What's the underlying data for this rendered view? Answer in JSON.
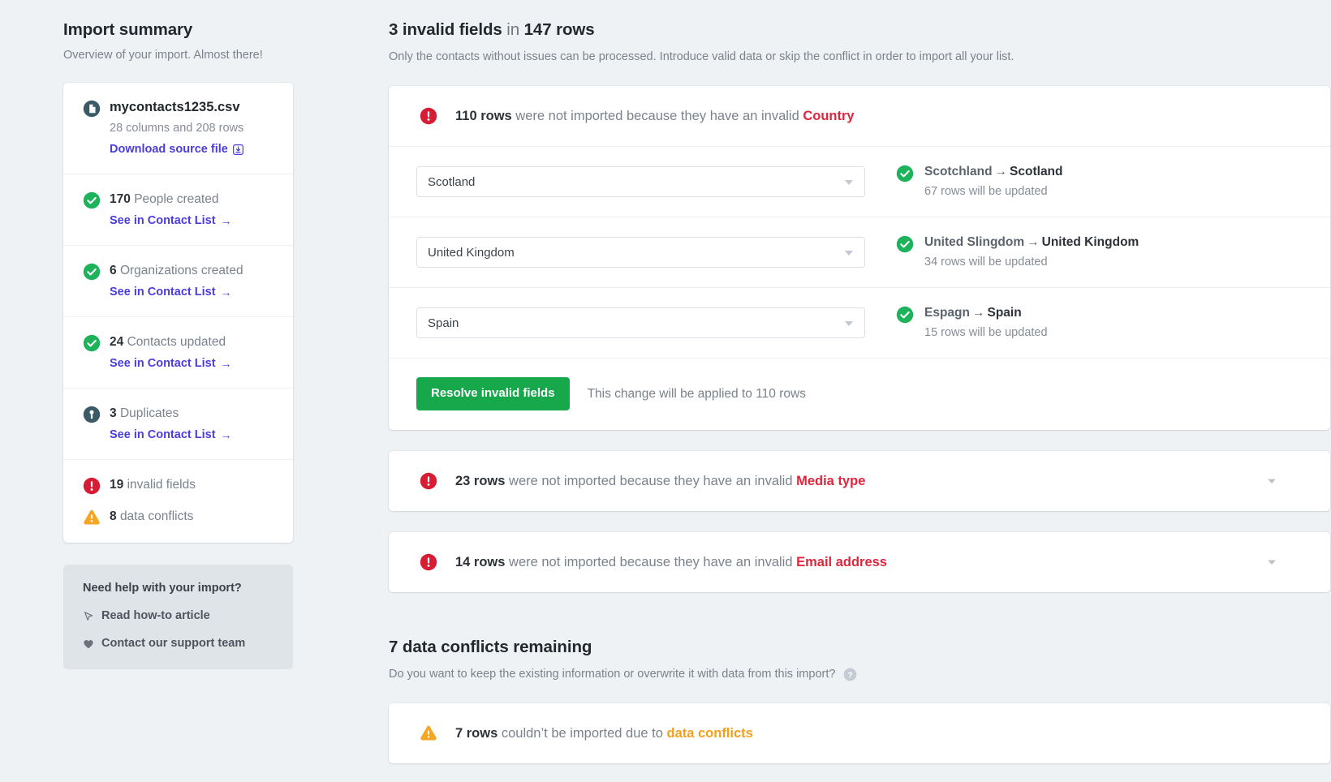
{
  "sidebar": {
    "title": "Import summary",
    "subtitle": "Overview of your import. Almost there!",
    "file": {
      "icon": "file-icon",
      "name": "mycontacts1235.csv",
      "meta": "28 columns and 208 rows",
      "download_label": "Download source file",
      "download_icon": "download-icon"
    },
    "stats": [
      {
        "icon": "check-circle-icon",
        "count": "170",
        "label": "People created",
        "link": "See in Contact List",
        "link_arrow": "→"
      },
      {
        "icon": "check-circle-icon",
        "count": "6",
        "label": "Organizations created",
        "link": "See in Contact List",
        "link_arrow": "→"
      },
      {
        "icon": "check-circle-icon",
        "count": "24",
        "label": "Contacts updated",
        "link": "See in Contact List",
        "link_arrow": "→"
      },
      {
        "icon": "duplicate-icon",
        "count": "3",
        "label": "Duplicates",
        "link": "See in Contact List",
        "link_arrow": "→"
      }
    ],
    "issues": [
      {
        "icon": "error-circle-icon",
        "count": "19",
        "label": "invalid fields"
      },
      {
        "icon": "warning-triangle-icon",
        "count": "8",
        "label": "data conflicts"
      }
    ],
    "help": {
      "title": "Need help with your import?",
      "links": [
        {
          "icon": "cursor-icon",
          "label": "Read how-to article"
        },
        {
          "icon": "heart-icon",
          "label": "Contact our support team"
        }
      ]
    }
  },
  "main": {
    "title_count": "3 invalid fields",
    "title_mid": " in ",
    "title_rows": "147 rows",
    "subtitle": "Only the contacts without issues can be processed. Introduce valid data or skip the conflict in order to import all your list.",
    "cards": [
      {
        "icon": "error-circle-icon",
        "count": "110 rows",
        "text": " were not imported because they have an invalid ",
        "field": "Country",
        "expanded": true,
        "rows": [
          {
            "select_value": "Scotland",
            "from": "Scotchland",
            "arrow": "→",
            "to": "Scotland",
            "sub": "67 rows will be updated",
            "status_icon": "check-circle-icon"
          },
          {
            "select_value": "United Kingdom",
            "from": "United Slingdom",
            "arrow": "→",
            "to": "United Kingdom",
            "sub": "34 rows will be updated",
            "status_icon": "check-circle-icon"
          },
          {
            "select_value": "Spain",
            "from": "Espagn",
            "arrow": "→",
            "to": "Spain",
            "sub": "15 rows will be updated",
            "status_icon": "check-circle-icon"
          }
        ],
        "resolve_button": "Resolve invalid fields",
        "resolve_note": "This change will be applied to 110 rows"
      },
      {
        "icon": "error-circle-icon",
        "count": "23 rows",
        "text": " were not imported because they have an invalid ",
        "field": "Media type",
        "expanded": false,
        "chevron_icon": "chevron-down-icon"
      },
      {
        "icon": "error-circle-icon",
        "count": "14 rows",
        "text": " were not imported because they have an invalid ",
        "field": "Email address",
        "expanded": false,
        "chevron_icon": "chevron-down-icon"
      }
    ],
    "conflicts": {
      "title": "7 data conflicts remaining",
      "subtitle": "Do you want to keep the existing information or overwrite it with data from this import?",
      "help_icon": "help-circle-icon",
      "card": {
        "icon": "warning-triangle-icon",
        "count": "7 rows",
        "text": " couldn’t be imported due to ",
        "field": "data conflicts"
      }
    }
  },
  "colors": {
    "page_bg": "#eff2f4",
    "accent_link": "#4b3ddb",
    "success_green": "#17a84c",
    "error_red": "#e0253c",
    "warning_orange": "#f0a020",
    "duplicate_teal": "#3c5a66"
  }
}
